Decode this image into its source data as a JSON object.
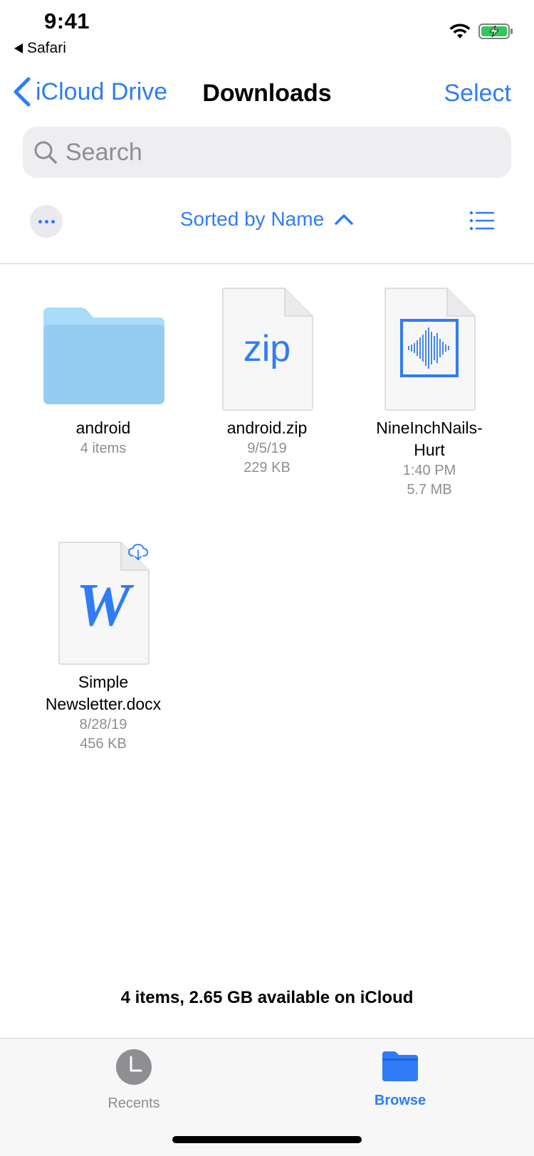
{
  "status": {
    "time": "9:41",
    "back_app": "Safari"
  },
  "nav": {
    "back_label": "iCloud Drive",
    "title": "Downloads",
    "select_label": "Select"
  },
  "search": {
    "placeholder": "Search",
    "value": ""
  },
  "sort": {
    "label": "Sorted by Name"
  },
  "files": [
    {
      "name": "android",
      "meta1": "4 items",
      "meta2": "",
      "type": "folder-icon"
    },
    {
      "name": "android.zip",
      "meta1": "9/5/19",
      "meta2": "229 KB",
      "type": "zip-file-icon",
      "icon_text": "zip"
    },
    {
      "name": "NineInchNails-Hurt",
      "name_line1": "NineInchNails-",
      "name_line2": "Hurt",
      "meta1": "1:40 PM",
      "meta2": "5.7 MB",
      "type": "audio-file-icon"
    },
    {
      "name": "Simple Newsletter.docx",
      "name_line1": "Simple",
      "name_line2": "Newsletter.docx",
      "meta1": "8/28/19",
      "meta2": "456 KB",
      "type": "word-file-icon",
      "icon_text": "W"
    }
  ],
  "footer": {
    "info": "4 items, 2.65 GB available on iCloud"
  },
  "tabs": [
    {
      "label": "Recents",
      "icon": "clock-icon"
    },
    {
      "label": "Browse",
      "icon": "folder-icon"
    }
  ],
  "colors": {
    "accent": "#2f7cf6",
    "secondary_text": "#8e8e93",
    "folder": "#9ed3f5"
  }
}
